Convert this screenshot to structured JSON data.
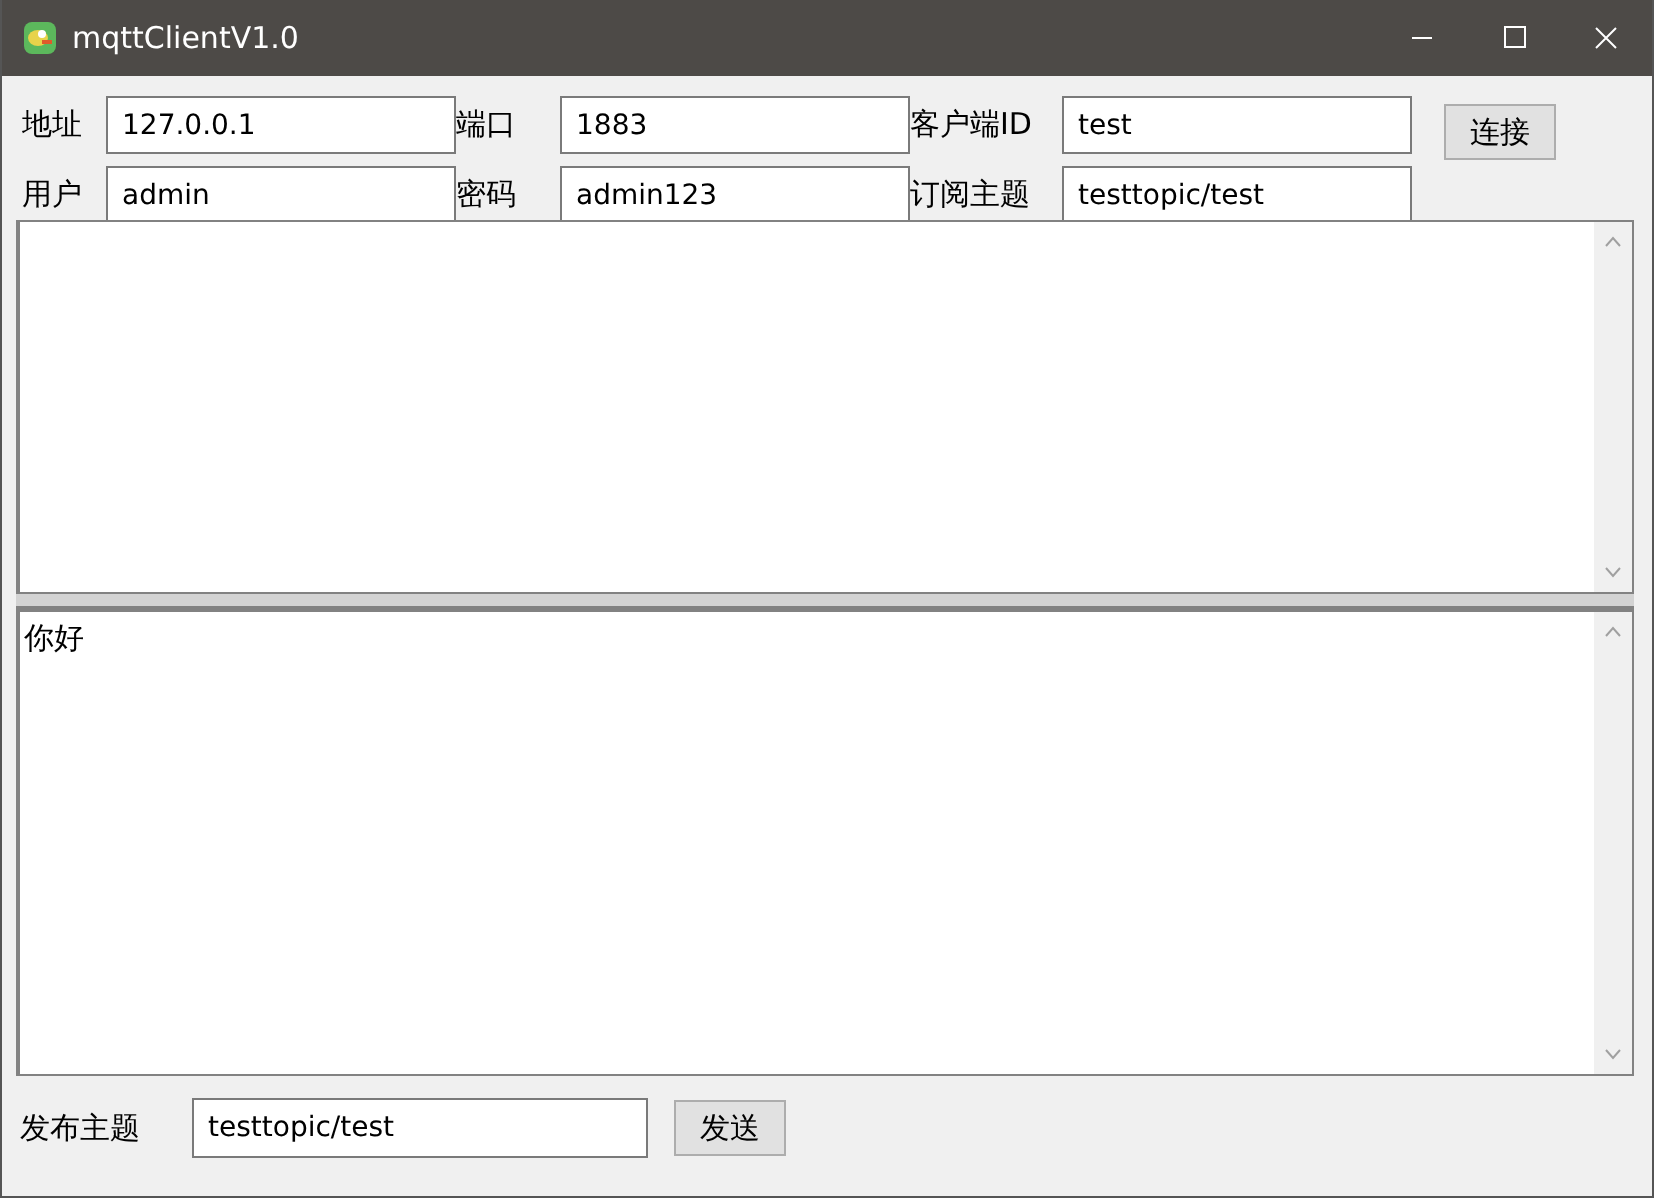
{
  "window": {
    "title": "mqttClientV1.0"
  },
  "fields": [
    {
      "label": "地址",
      "value": "127.0.0.1"
    },
    {
      "label": "端口",
      "value": "1883"
    },
    {
      "label": "客户端ID",
      "value": "test"
    },
    {
      "label": "用户",
      "value": "admin"
    },
    {
      "label": "密码",
      "value": "admin123"
    },
    {
      "label": "订阅主题",
      "value": "testtopic/test"
    }
  ],
  "connect_button": "连接",
  "message_area": {
    "value": "你好"
  },
  "publish": {
    "label": "发布主题",
    "value": "testtopic/test"
  },
  "send_button": "发送"
}
